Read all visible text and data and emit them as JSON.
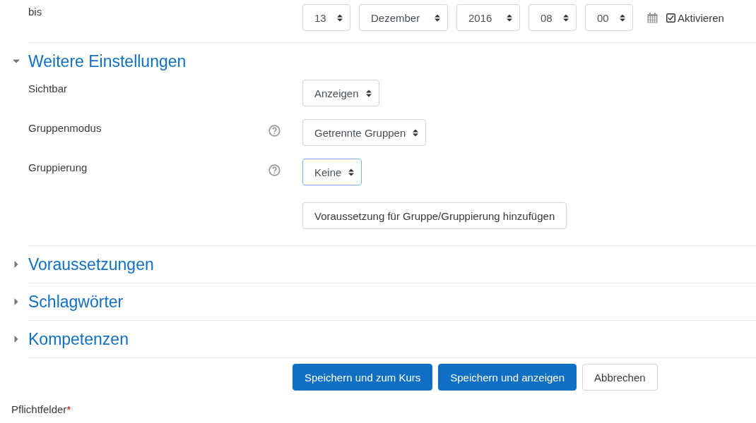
{
  "date_row": {
    "label": "bis",
    "selects": [
      "13",
      "Dezember",
      "2016",
      "08",
      "00"
    ],
    "enable": {
      "label": "Aktivieren",
      "checked": true
    }
  },
  "sections": [
    {
      "title": "Weitere Einstellungen",
      "expanded": true,
      "fields": [
        {
          "label": "Sichtbar",
          "help": false,
          "value": "Anzeigen",
          "focused": false
        },
        {
          "label": "Gruppenmodus",
          "help": true,
          "value": "Getrennte Gruppen",
          "focused": false
        },
        {
          "label": "Gruppierung",
          "help": true,
          "value": "Keine",
          "focused": true
        }
      ],
      "button": "Voraussetzung für Gruppe/Gruppierung hinzufügen"
    },
    {
      "title": "Voraussetzungen",
      "expanded": false
    },
    {
      "title": "Schlagwörter",
      "expanded": false
    },
    {
      "title": "Kompetenzen",
      "expanded": false
    }
  ],
  "buttons": [
    {
      "label": "Speichern und zum Kurs",
      "kind": "primary"
    },
    {
      "label": "Speichern und anzeigen",
      "kind": "primary"
    },
    {
      "label": "Abbrechen",
      "kind": "secondary"
    }
  ],
  "required_note": {
    "label": "Pflichtfelder",
    "marker": "*"
  }
}
